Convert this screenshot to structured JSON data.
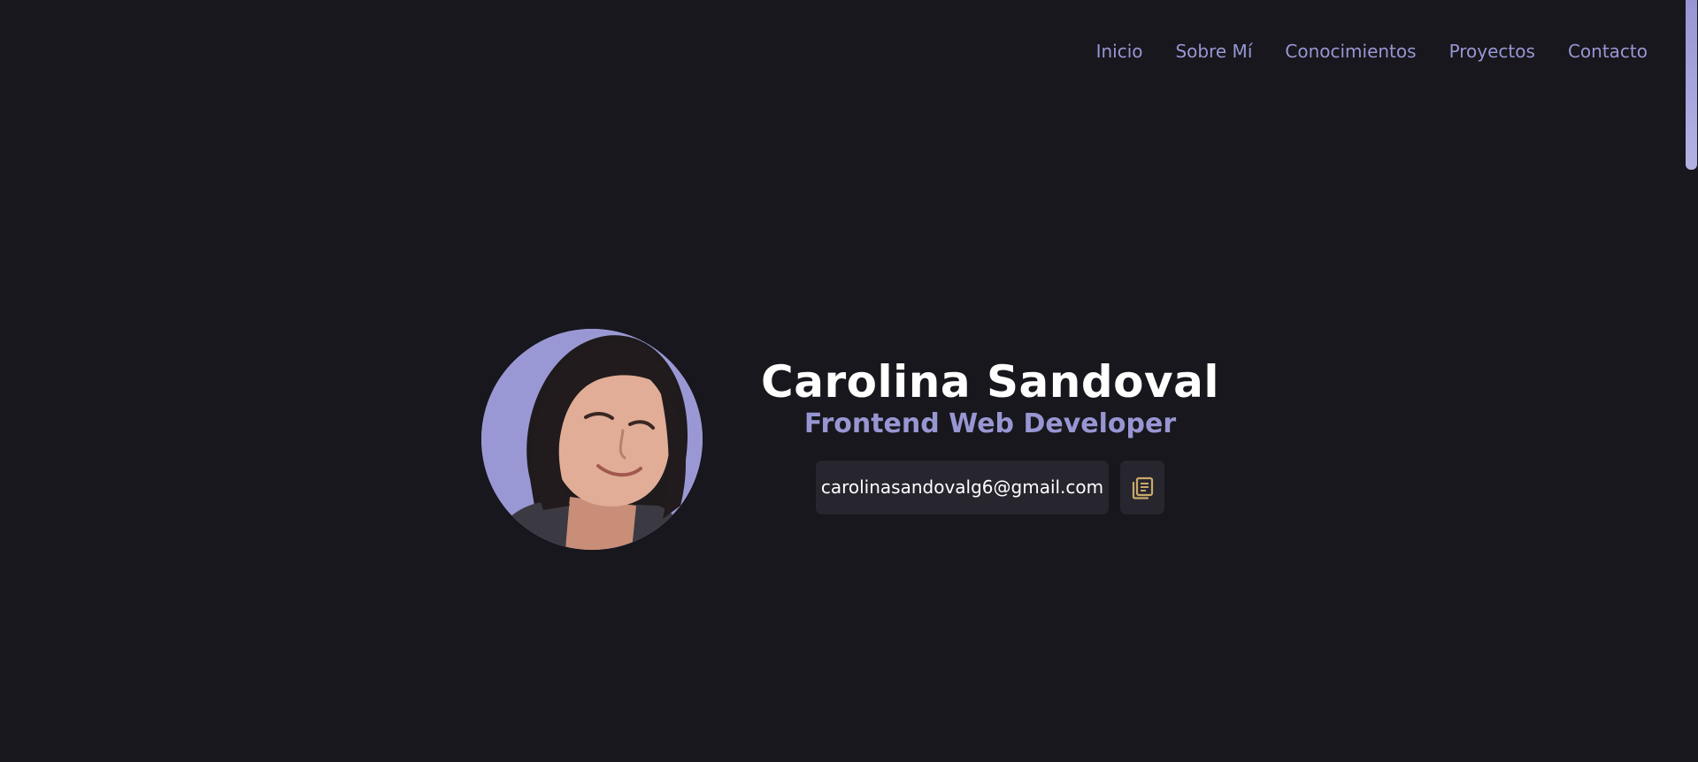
{
  "nav": {
    "items": [
      {
        "label": "Inicio"
      },
      {
        "label": "Sobre Mí"
      },
      {
        "label": "Conocimientos"
      },
      {
        "label": "Proyectos"
      },
      {
        "label": "Contacto"
      }
    ]
  },
  "hero": {
    "name": "Carolina Sandoval",
    "role": "Frontend Web Developer",
    "email": "carolinasandovalg6@gmail.com",
    "copy_icon": "copy-icon"
  },
  "colors": {
    "background": "#17171d",
    "accent": "#9896d2",
    "box": "#27262f",
    "icon": "#c9a96a"
  }
}
